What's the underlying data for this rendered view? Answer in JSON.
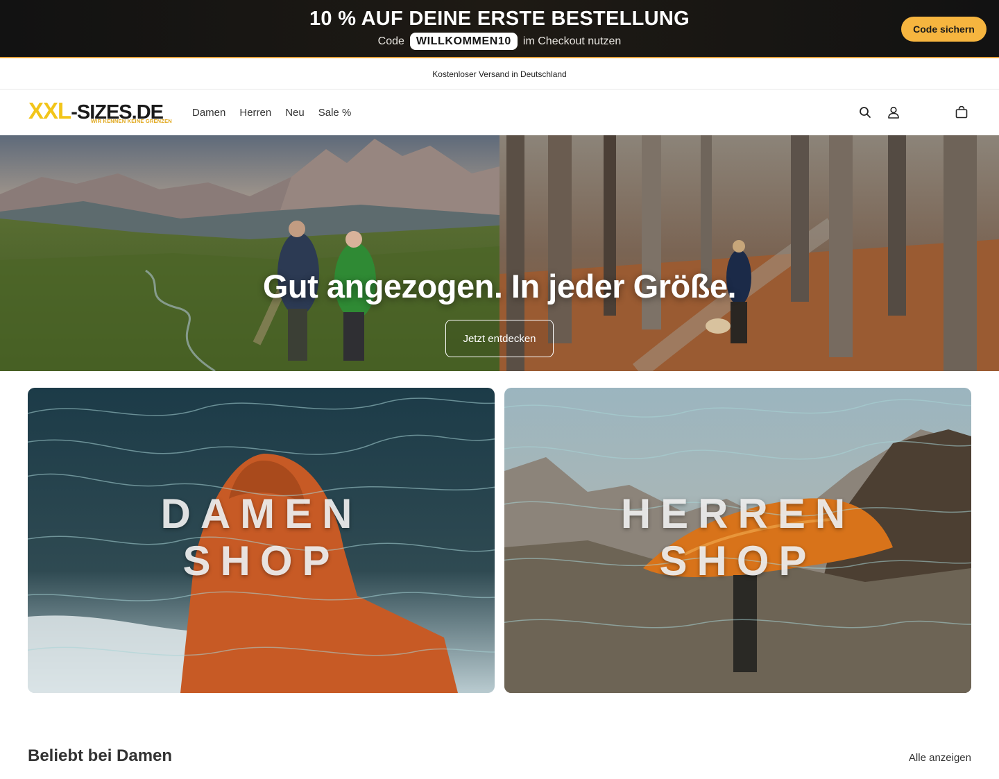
{
  "promo": {
    "title": "10 % AUF DEINE ERSTE BESTELLUNG",
    "code_prefix": "Code",
    "code": "WILLKOMMEN10",
    "code_suffix": "im Checkout nutzen",
    "button_label": "Code sichern",
    "accent_color": "#f6b53f"
  },
  "shipping": {
    "text": "Kostenloser Versand in Deutschland"
  },
  "header": {
    "logo": {
      "brand": "XXL",
      "rest": "-SIZES.DE",
      "tagline": "WIR KENNEN KEINE GRENZEN"
    },
    "nav": [
      "Damen",
      "Herren",
      "Neu",
      "Sale %"
    ],
    "icons": [
      "search-icon",
      "account-icon",
      "cart-icon"
    ]
  },
  "hero": {
    "title": "Gut angezogen. In jeder Größe.",
    "button_label": "Jetzt entdecken"
  },
  "tiles": [
    {
      "line1": "DAMEN",
      "line2": "SHOP"
    },
    {
      "line1": "HERREN",
      "line2": "SHOP"
    }
  ],
  "section": {
    "title": "Beliebt bei Damen",
    "link_label": "Alle anzeigen"
  }
}
